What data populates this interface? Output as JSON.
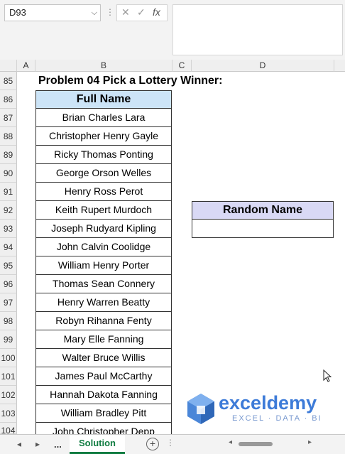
{
  "formula_bar": {
    "name_box": "D93",
    "fx_label": "fx",
    "formula": ""
  },
  "columns": [
    "A",
    "B",
    "C",
    "D"
  ],
  "rows": [
    "85",
    "86",
    "87",
    "88",
    "89",
    "90",
    "91",
    "92",
    "93",
    "94",
    "95",
    "96",
    "97",
    "98",
    "99",
    "100",
    "101",
    "102",
    "103",
    "104"
  ],
  "sheet": {
    "title": "Problem 04 Pick a Lottery Winner:",
    "names_header": "Full Name",
    "names": [
      "Brian Charles Lara",
      "Christopher Henry Gayle",
      "Ricky Thomas Ponting",
      "George Orson Welles",
      "Henry Ross Perot",
      "Keith Rupert Murdoch",
      "Joseph Rudyard Kipling",
      "John Calvin Coolidge",
      "William Henry Porter",
      "Thomas Sean Connery",
      "Henry Warren Beatty",
      "Robyn Rihanna Fenty",
      "Mary Elle Fanning",
      "Walter Bruce Willis",
      "James Paul McCarthy",
      "Hannah Dakota Fanning",
      "William Bradley Pitt",
      "John Christopher Depp"
    ],
    "random_header": "Random Name",
    "random_value": ""
  },
  "logo": {
    "name": "exceldemy",
    "tagline": "EXCEL · DATA · BI"
  },
  "tabs": {
    "more": "...",
    "active": "Solution"
  },
  "colors": {
    "name_header_bg": "#cce4f7",
    "random_header_bg": "#d9d9f5",
    "tab_accent": "#107c41",
    "logo_blue": "#3d7bd8"
  }
}
